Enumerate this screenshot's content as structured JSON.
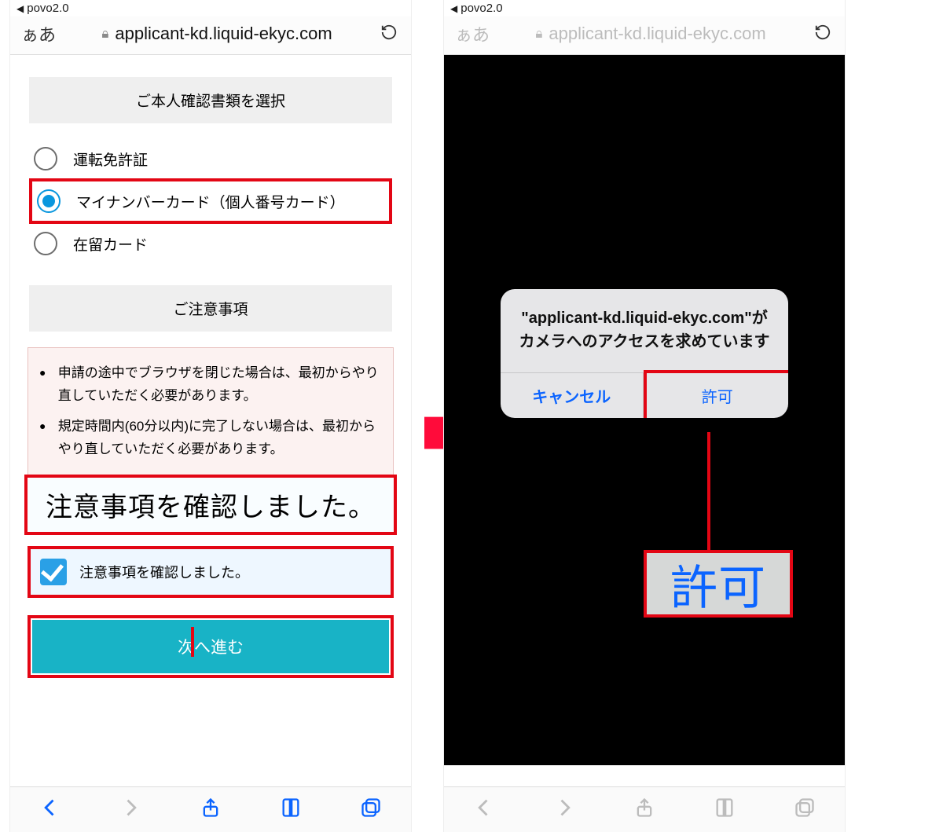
{
  "status_back_app": "povo2.0",
  "urlbar": {
    "aa": "ぁあ",
    "domain": "applicant-kd.liquid-ekyc.com"
  },
  "left": {
    "section1_title": "ご本人確認書類を選択",
    "radio_options": [
      "運転免許証",
      "マイナンバーカード（個人番号カード）",
      "在留カード"
    ],
    "section2_title": "ご注意事項",
    "notices": [
      "申請の途中でブラウザを閉じた場合は、最初からやり直していただく必要があります。",
      "規定時間内(60分以内)に完了しない場合は、最初からやり直していただく必要があります。"
    ],
    "callout_big": "注意事項を確認しました。",
    "checkbox_label": "注意事項を確認しました。",
    "next_button": "次へ進む"
  },
  "right": {
    "alert_message": "\"applicant-kd.liquid-ekyc.com\"がカメラへのアクセスを求めています",
    "cancel": "キャンセル",
    "allow": "許可",
    "allow_big": "許可"
  }
}
